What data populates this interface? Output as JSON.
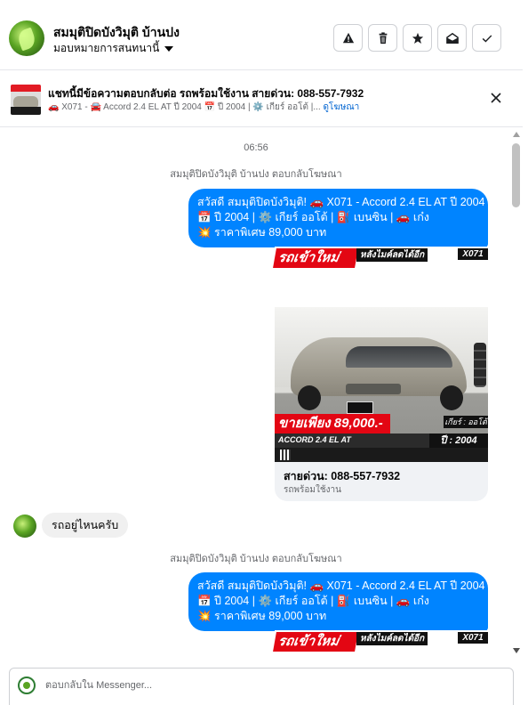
{
  "header": {
    "name": "สมมุติปิดบังวิมุติ บ้านปง",
    "assign_label": "มอบหมายการสนทนานี้",
    "buttons": [
      "warning-button",
      "delete-button",
      "star-button",
      "mark-unread-button",
      "done-button"
    ]
  },
  "ad_bar": {
    "title": "แชทนี้มีข้อความตอบกลับต่อ รถพร้อมใช้งาน สายด่วน: 088-557-7932",
    "desc": "🚗 X071 - 🚘 Accord 2.4 EL AT ปี 2004 📅 ปี 2004 | ⚙️ เกียร์ ออโต้ |...",
    "link": "ดูโฆษณา"
  },
  "chat": {
    "time": "06:56",
    "reply_note": "สมมุติปิดบังวิมุติ บ้านปง ตอบกลับโฆษณา",
    "out_message_lines": [
      "สวัสดี สมมุติปิดบังวิมุติ! 🚗 X071 - Accord 2.4 EL AT ปี 2004",
      "📅 ปี 2004 | ⚙️ เกียร์ ออโต้ | ⛽ เบนซิน | 🚗 เก๋ง",
      "💥 ราคาพิเศษ 89,000 บาท"
    ],
    "banner": {
      "red_text": "รถเข้าใหม่",
      "black_text": "หลังไมค์ลดได้อีก",
      "code": "X071"
    },
    "card": {
      "price_text": "ขายเพียง 89,000.-",
      "gear_text": "เกียร์ : ออโต้",
      "model_text": "ACCORD 2.4 EL AT",
      "year_text": "ปี : 2004",
      "caption": "สายด่วน: 088-557-7932",
      "sub": "รถพร้อมใช้งาน"
    },
    "in_message": "รถอยู่ไหนครับ"
  },
  "composer": {
    "placeholder": "ตอบกลับใน Messenger..."
  }
}
